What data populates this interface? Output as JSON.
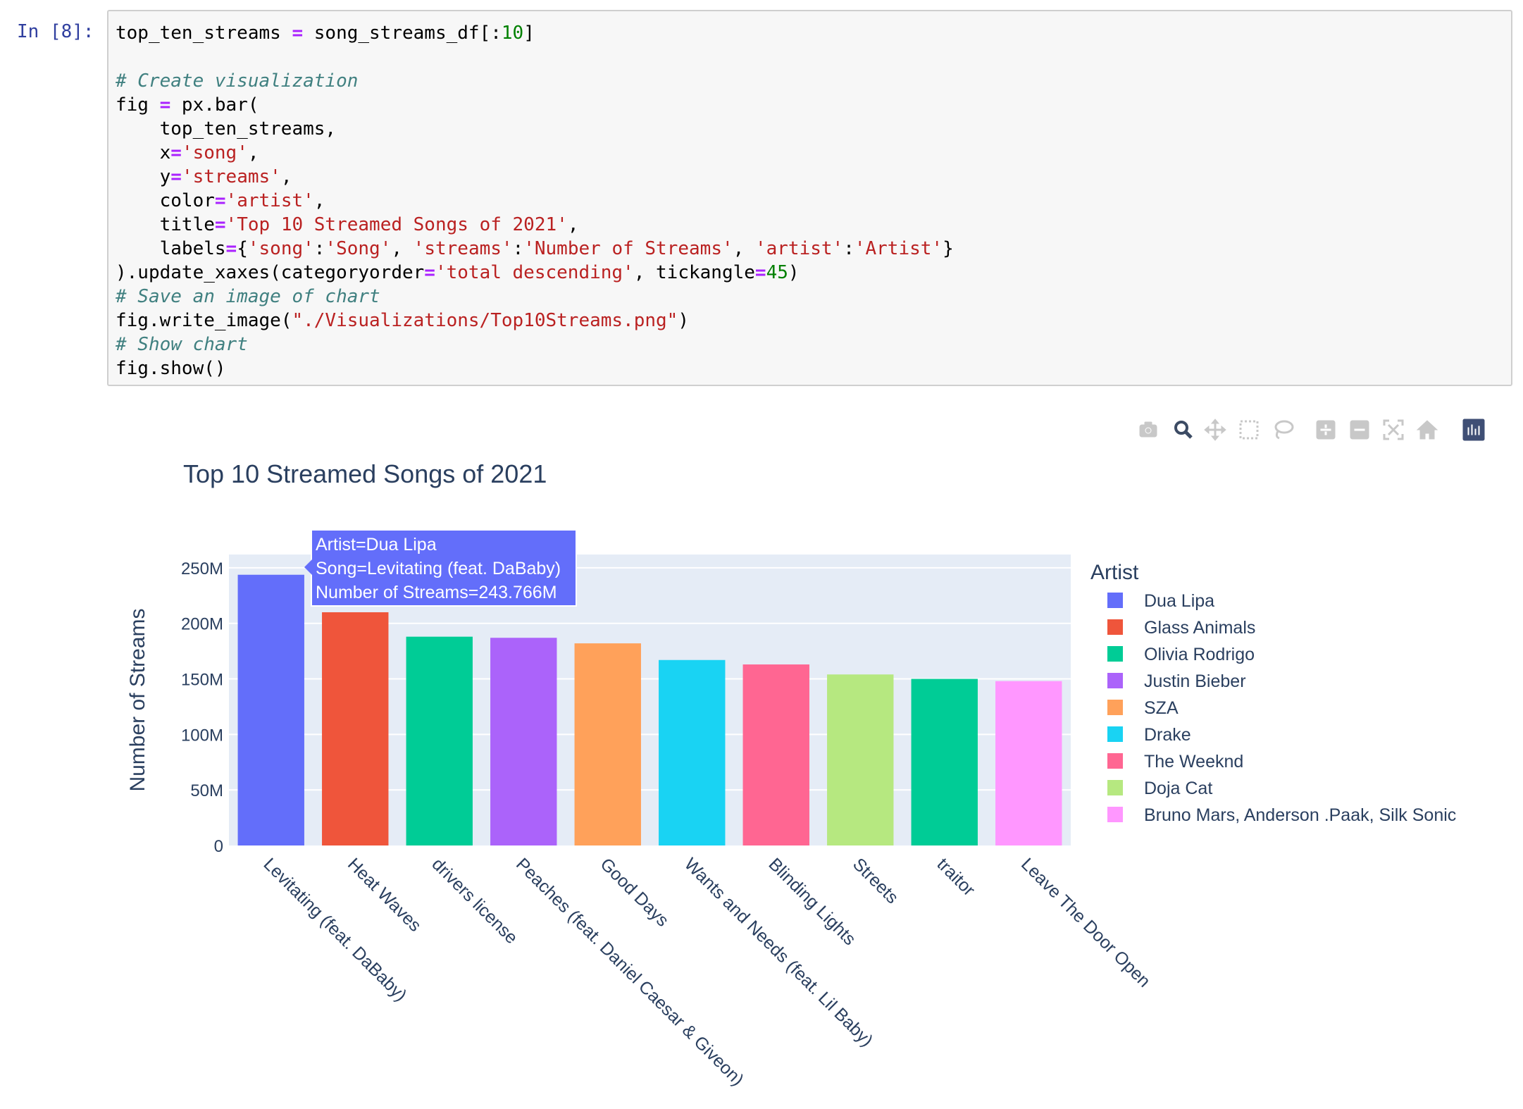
{
  "cell": {
    "prompt": "In [8]:",
    "lines": [
      [
        {
          "t": "top_ten_streams "
        },
        {
          "t": "=",
          "c": "op"
        },
        {
          "t": " song_streams_df[:"
        },
        {
          "t": "10",
          "c": "nu"
        },
        {
          "t": "]"
        }
      ],
      [],
      [
        {
          "t": "# Create visualization",
          "c": "cm"
        }
      ],
      [
        {
          "t": "fig "
        },
        {
          "t": "=",
          "c": "op"
        },
        {
          "t": " px.bar("
        }
      ],
      [
        {
          "t": "    top_ten_streams,"
        }
      ],
      [
        {
          "t": "    x"
        },
        {
          "t": "=",
          "c": "op"
        },
        {
          "t": "'song'",
          "c": "st"
        },
        {
          "t": ","
        }
      ],
      [
        {
          "t": "    y"
        },
        {
          "t": "=",
          "c": "op"
        },
        {
          "t": "'streams'",
          "c": "st"
        },
        {
          "t": ","
        }
      ],
      [
        {
          "t": "    color"
        },
        {
          "t": "=",
          "c": "op"
        },
        {
          "t": "'artist'",
          "c": "st"
        },
        {
          "t": ","
        }
      ],
      [
        {
          "t": "    title"
        },
        {
          "t": "=",
          "c": "op"
        },
        {
          "t": "'Top 10 Streamed Songs of 2021'",
          "c": "st"
        },
        {
          "t": ","
        }
      ],
      [
        {
          "t": "    labels"
        },
        {
          "t": "=",
          "c": "op"
        },
        {
          "t": "{"
        },
        {
          "t": "'song'",
          "c": "st"
        },
        {
          "t": ":"
        },
        {
          "t": "'Song'",
          "c": "st"
        },
        {
          "t": ", "
        },
        {
          "t": "'streams'",
          "c": "st"
        },
        {
          "t": ":"
        },
        {
          "t": "'Number of Streams'",
          "c": "st"
        },
        {
          "t": ", "
        },
        {
          "t": "'artist'",
          "c": "st"
        },
        {
          "t": ":"
        },
        {
          "t": "'Artist'",
          "c": "st"
        },
        {
          "t": "}"
        }
      ],
      [
        {
          "t": ").update_xaxes(categoryorder"
        },
        {
          "t": "=",
          "c": "op"
        },
        {
          "t": "'total descending'",
          "c": "st"
        },
        {
          "t": ", tickangle"
        },
        {
          "t": "=",
          "c": "op"
        },
        {
          "t": "45",
          "c": "nu"
        },
        {
          "t": ")"
        }
      ],
      [
        {
          "t": "# Save an image of chart",
          "c": "cm"
        }
      ],
      [
        {
          "t": "fig.write_image("
        },
        {
          "t": "\"./Visualizations/Top10Streams.png\"",
          "c": "st"
        },
        {
          "t": ")"
        }
      ],
      [
        {
          "t": "# Show chart",
          "c": "cm"
        }
      ],
      [
        {
          "t": "fig.show()"
        }
      ]
    ]
  },
  "modebar": [
    {
      "name": "download-plot-icon",
      "color": "#c8c8c8"
    },
    {
      "name": "zoom-icon",
      "color": "#3c4b64"
    },
    {
      "name": "pan-icon",
      "color": "#c8c8c8"
    },
    {
      "name": "box-select-icon",
      "color": "#c8c8c8"
    },
    {
      "name": "lasso-select-icon",
      "color": "#c8c8c8"
    },
    {
      "name": "zoom-in-icon",
      "color": "#c8c8c8"
    },
    {
      "name": "zoom-out-icon",
      "color": "#c8c8c8"
    },
    {
      "name": "autoscale-icon",
      "color": "#c8c8c8"
    },
    {
      "name": "reset-axes-icon",
      "color": "#c8c8c8"
    },
    {
      "name": "plotly-logo-icon",
      "color": "#3f4f75"
    }
  ],
  "chart_data": {
    "type": "bar",
    "title": "Top 10 Streamed Songs of 2021",
    "xlabel": "",
    "ylabel": "Number of Streams",
    "ylim": [
      0,
      262000000
    ],
    "yticks": [
      0,
      50000000,
      100000000,
      150000000,
      200000000,
      250000000
    ],
    "ytick_labels": [
      "0",
      "50M",
      "100M",
      "150M",
      "200M",
      "250M"
    ],
    "tickangle": 45,
    "grid": true,
    "legend_title": "Artist",
    "legend_placement": "right",
    "categories": [
      "Levitating (feat. DaBaby)",
      "Heat Waves",
      "drivers license",
      "Peaches (feat. Daniel Caesar & Giveon)",
      "Good Days",
      "Wants and Needs (feat. Lil Baby)",
      "Blinding Lights",
      "Streets",
      "traitor",
      "Leave The Door Open"
    ],
    "values": [
      243766000,
      210000000,
      188000000,
      187000000,
      182000000,
      167000000,
      163000000,
      154000000,
      150000000,
      148000000
    ],
    "series_artist": [
      "Dua Lipa",
      "Glass Animals",
      "Olivia Rodrigo",
      "Justin Bieber",
      "SZA",
      "Drake",
      "The Weeknd",
      "Doja Cat",
      "Olivia Rodrigo",
      "Bruno Mars, Anderson .Paak, Silk Sonic"
    ],
    "legend": [
      {
        "name": "Dua Lipa",
        "color": "#636EFA"
      },
      {
        "name": "Glass Animals",
        "color": "#EF553B"
      },
      {
        "name": "Olivia Rodrigo",
        "color": "#00CC96"
      },
      {
        "name": "Justin Bieber",
        "color": "#AB63FA"
      },
      {
        "name": "SZA",
        "color": "#FFA15A"
      },
      {
        "name": "Drake",
        "color": "#19D3F3"
      },
      {
        "name": "The Weeknd",
        "color": "#FF6692"
      },
      {
        "name": "Doja Cat",
        "color": "#B6E880"
      },
      {
        "name": "Bruno Mars, Anderson .Paak, Silk Sonic",
        "color": "#FF97FF"
      }
    ],
    "tooltip": {
      "lines": [
        "Artist=Dua Lipa",
        "Song=Levitating (feat. DaBaby)",
        "Number of Streams=243.766M"
      ],
      "color": "#636EFA"
    }
  }
}
